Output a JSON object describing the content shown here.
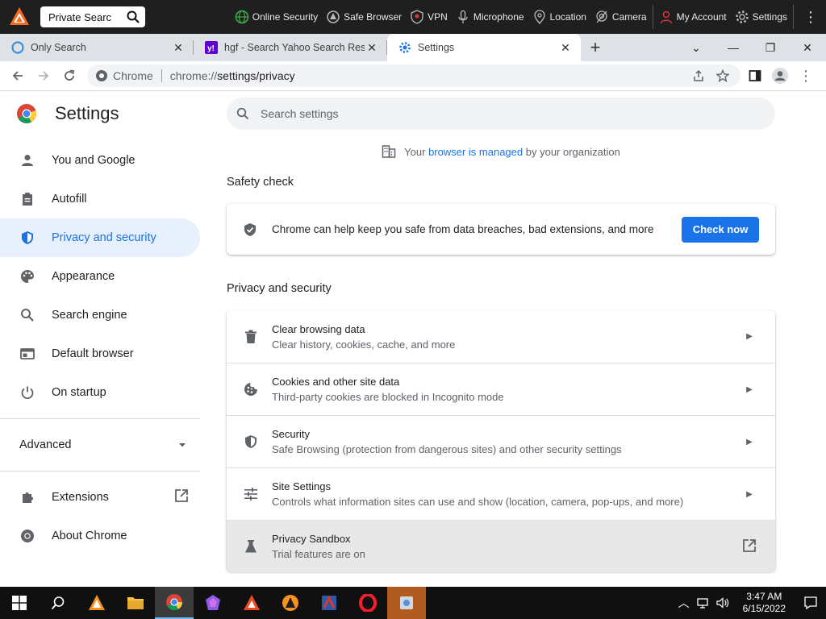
{
  "topbar": {
    "search_text": "Private Searc",
    "features": [
      {
        "label": "Online Security",
        "icon": "globe-icon"
      },
      {
        "label": "Safe Browser",
        "icon": "safe-browser-icon"
      },
      {
        "label": "VPN",
        "icon": "vpn-shield-icon"
      },
      {
        "label": "Microphone",
        "icon": "microphone-icon"
      },
      {
        "label": "Location",
        "icon": "location-pin-icon"
      },
      {
        "label": "Camera",
        "icon": "camera-icon"
      }
    ],
    "account_label": "My Account",
    "settings_label": "Settings"
  },
  "tabs": [
    {
      "title": "Only Search",
      "active": false
    },
    {
      "title": "hgf - Search Yahoo Search Results",
      "active": false
    },
    {
      "title": "Settings",
      "active": true
    }
  ],
  "address": {
    "chip": "Chrome",
    "url_prefix": "chrome://",
    "url_path": "settings/privacy"
  },
  "sidebar": {
    "title": "Settings",
    "items": [
      {
        "label": "You and Google"
      },
      {
        "label": "Autofill"
      },
      {
        "label": "Privacy and security"
      },
      {
        "label": "Appearance"
      },
      {
        "label": "Search engine"
      },
      {
        "label": "Default browser"
      },
      {
        "label": "On startup"
      }
    ],
    "advanced": "Advanced",
    "extensions": "Extensions",
    "about": "About Chrome"
  },
  "main": {
    "search_placeholder": "Search settings",
    "managed_prefix": "Your",
    "managed_link": "browser is managed",
    "managed_suffix": "by your organization",
    "safety_title": "Safety check",
    "safety_text": "Chrome can help keep you safe from data breaches, bad extensions, and more",
    "check_now": "Check now",
    "privacy_title": "Privacy and security",
    "rows": [
      {
        "title": "Clear browsing data",
        "sub": "Clear history, cookies, cache, and more"
      },
      {
        "title": "Cookies and other site data",
        "sub": "Third-party cookies are blocked in Incognito mode"
      },
      {
        "title": "Security",
        "sub": "Safe Browsing (protection from dangerous sites) and other security settings"
      },
      {
        "title": "Site Settings",
        "sub": "Controls what information sites can use and show (location, camera, pop-ups, and more)"
      },
      {
        "title": "Privacy Sandbox",
        "sub": "Trial features are on"
      }
    ]
  },
  "taskbar": {
    "time": "3:47 AM",
    "date": "6/15/2022"
  },
  "colors": {
    "accent": "#1a73e8",
    "active_nav_bg": "#e8f0fe"
  }
}
